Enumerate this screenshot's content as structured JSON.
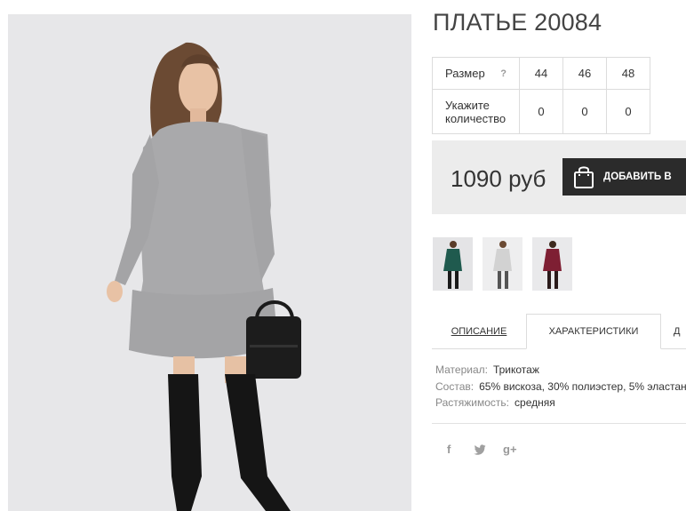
{
  "product": {
    "title": "ПЛАТЬЕ 20084"
  },
  "size_table": {
    "size_label": "Размер",
    "help_icon": "?",
    "sizes": [
      "44",
      "46",
      "48"
    ],
    "qty_label": "Укажите количество",
    "quantities": [
      "0",
      "0",
      "0"
    ]
  },
  "price": {
    "value": "1090 руб",
    "button_label": "ДОБАВИТЬ В",
    "button_icon": "shopping-bag-icon"
  },
  "variants": [
    {
      "color": "#1f5a4e",
      "name": "green"
    },
    {
      "color": "#d2d2d2",
      "name": "light-gray"
    },
    {
      "color": "#7e1f33",
      "name": "burgundy"
    }
  ],
  "tabs": {
    "description": "ОПИСАНИЕ",
    "characteristics": "ХАРАКТЕРИСТИКИ",
    "third": "Д"
  },
  "specs": [
    {
      "key": "Материал:",
      "value": "Трикотаж"
    },
    {
      "key": "Состав:",
      "value": "65% вискоза, 30% полиэстер, 5% эластан"
    },
    {
      "key": "Растяжимость:",
      "value": "средняя"
    }
  ],
  "social": {
    "facebook": "f",
    "twitter": "twitter-icon",
    "gplus": "g+"
  },
  "colors": {
    "button_bg": "#2b2b2b",
    "price_box_bg": "#ececec",
    "dress": "#a9a9ab"
  }
}
